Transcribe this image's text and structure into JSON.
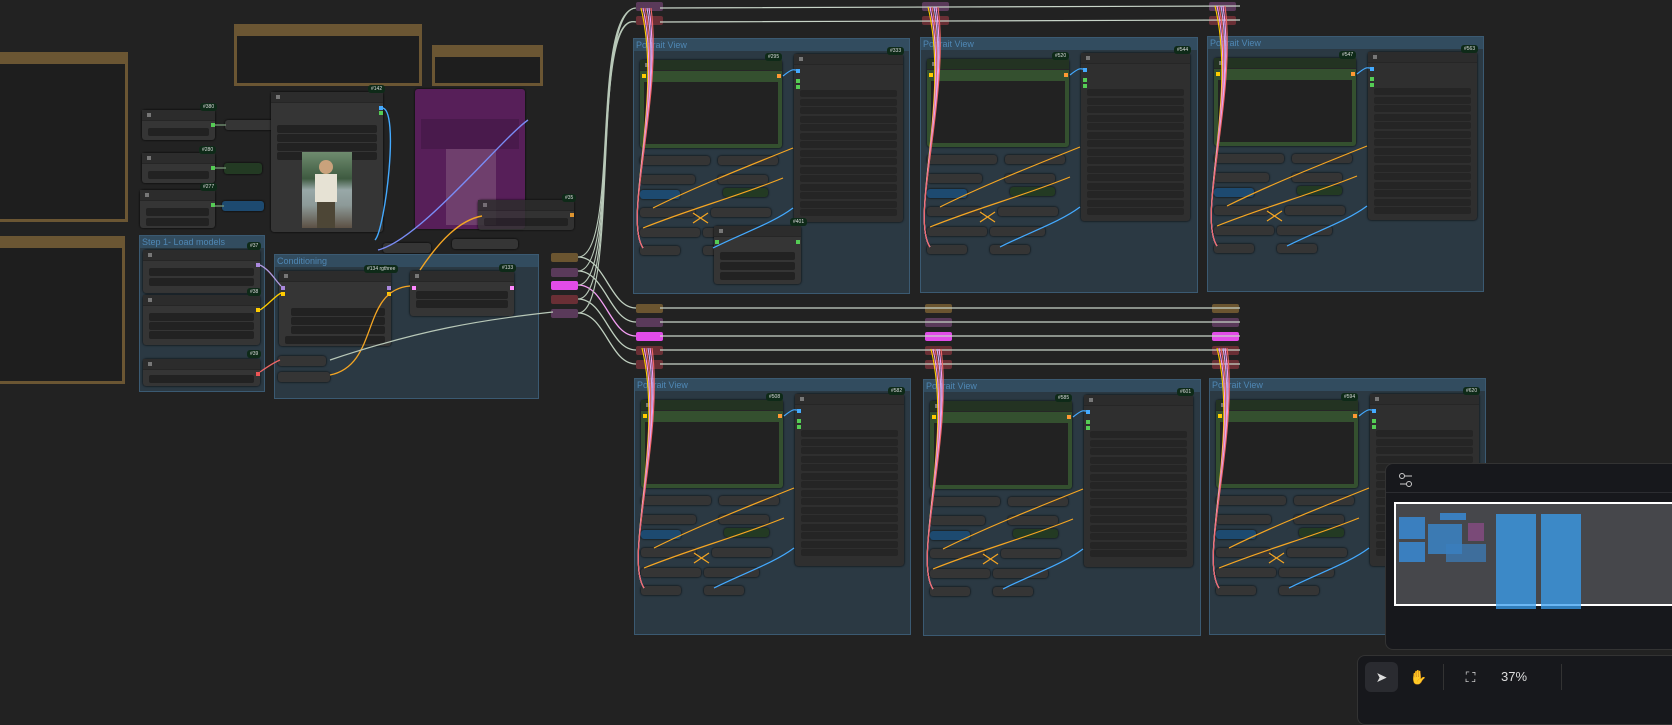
{
  "groups": {
    "load_models": "Step 1- Load models",
    "conditioning": "Conditioning",
    "portrait_views": [
      "Portrait View",
      "Portrait View",
      "Portrait View",
      "Portrait View",
      "Portrait View",
      "Portrait View"
    ]
  },
  "badges": {
    "n380": "#380",
    "n280": "#280",
    "n277": "#277",
    "n142": "#142",
    "n37": "#37",
    "n38": "#38",
    "n39": "#39",
    "n134": "#134 rgthree",
    "n133": "#133",
    "n35": "#35",
    "n401": "#401"
  },
  "portrait_badges": [
    [
      "#295",
      "#333"
    ],
    [
      "#520",
      "#544"
    ],
    [
      "#547",
      "#563"
    ],
    [
      "#508",
      "#582"
    ],
    [
      "#585",
      "#601"
    ],
    [
      "#594",
      "#620"
    ]
  ],
  "colors": {
    "group": "#3c6482",
    "frame": "#6b5633",
    "magenta": "#5a1f5c",
    "selection": "#ffffff"
  },
  "toolbar": {
    "select_icon": "pointer-icon",
    "pan_icon": "hand-icon",
    "fit_icon": "fit-view-icon",
    "zoom_level": "37%"
  },
  "minimap": {
    "settings_icon": "sliders-icon"
  }
}
